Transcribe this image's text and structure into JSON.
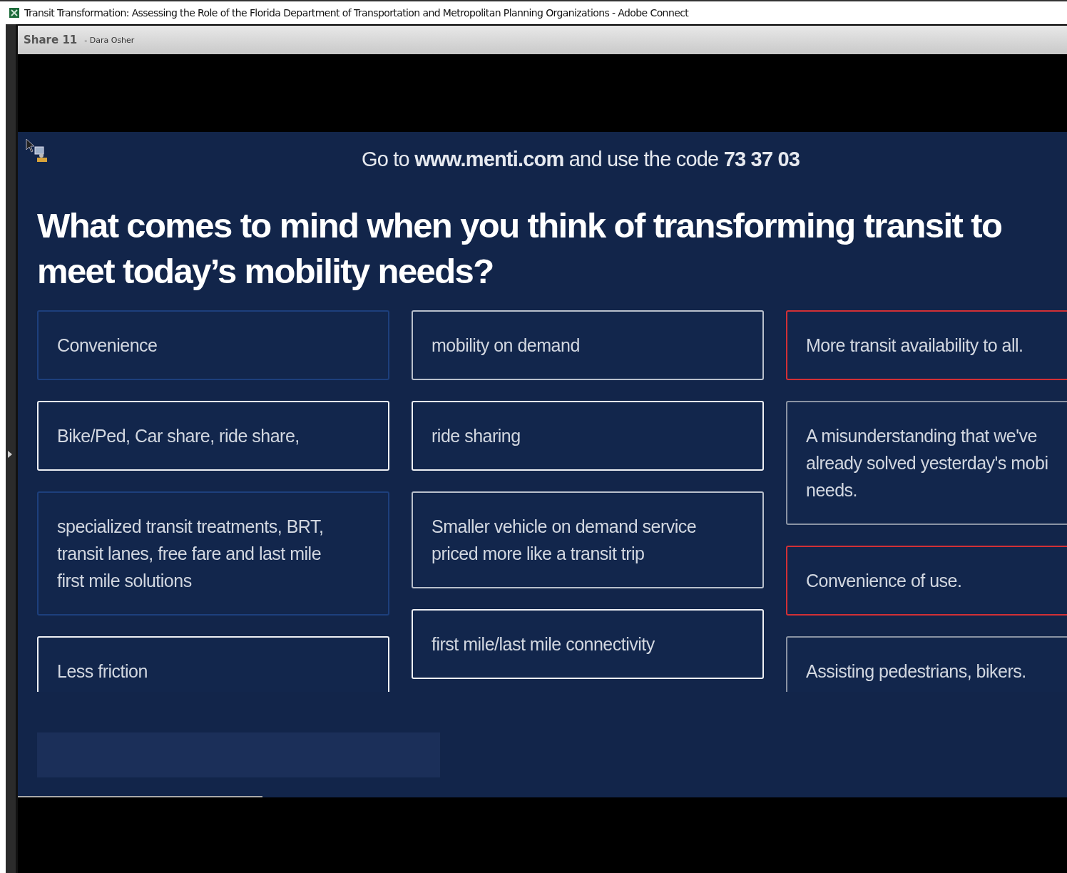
{
  "window": {
    "title": "Transit Transformation: Assessing the Role of the Florida Department of Transportation and Metropolitan Planning Organizations - Adobe Connect"
  },
  "pod": {
    "title": "Share 11",
    "presenter": "- Dara Osher"
  },
  "slide": {
    "instructions": "Go to **www.menti.com** and use the code **73 37 03**",
    "question": [
      "What comes to mind when you think of transforming transit to",
      "meet today’s mobility needs?"
    ],
    "columns": [
      {
        "cards": [
          {
            "lines": [
              "Convenience"
            ],
            "color": "#1d3f7c"
          },
          {
            "lines": [
              "Bike/Ped, Car share, ride share,"
            ],
            "color": "#eef0f4"
          },
          {
            "lines": [
              "specialized transit treatments, BRT,",
              "transit lanes, free fare and last mile",
              "first mile solutions"
            ],
            "color": "#1d3f7c"
          },
          {
            "lines": [
              "Less friction"
            ],
            "color": "#eef0f4"
          }
        ]
      },
      {
        "cards": [
          {
            "lines": [
              "mobility on demand"
            ],
            "color": "#b9c0cc"
          },
          {
            "lines": [
              "ride sharing"
            ],
            "color": "#eef0f4"
          },
          {
            "lines": [
              "Smaller vehicle on demand service",
              "priced more like a transit trip"
            ],
            "color": "#b9c0cc"
          },
          {
            "lines": [
              "first mile/last mile connectivity"
            ],
            "color": "#eef0f4"
          }
        ]
      },
      {
        "cards": [
          {
            "lines": [
              "More transit availability to all."
            ],
            "color": "#d23036"
          },
          {
            "lines": [
              "A misunderstanding that we've",
              "already solved yesterday's mobi",
              "needs."
            ],
            "color": "#8a93a3"
          },
          {
            "lines": [
              "Convenience of use."
            ],
            "color": "#d23036"
          },
          {
            "lines": [
              "Assisting pedestrians, bikers."
            ],
            "color": "#8a93a3"
          }
        ]
      }
    ]
  }
}
